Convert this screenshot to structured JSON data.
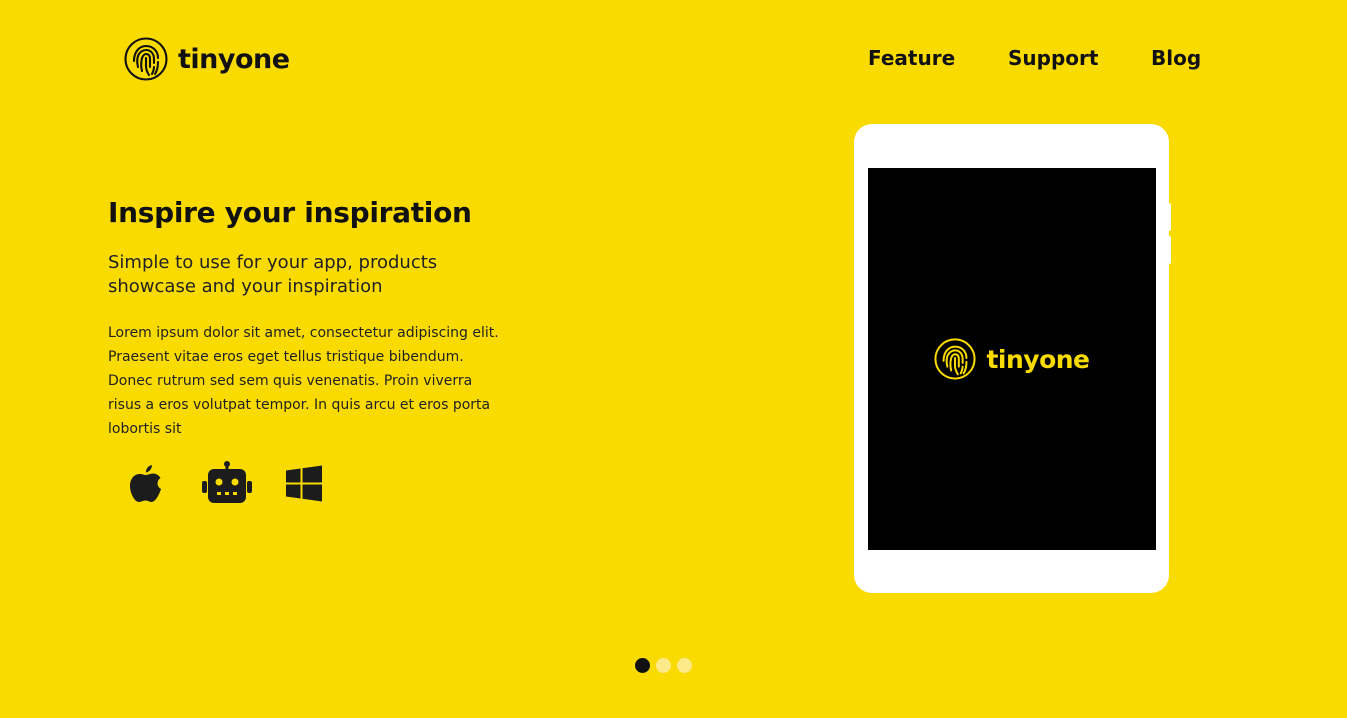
{
  "brand": {
    "name": "tinyone"
  },
  "nav": {
    "items": [
      {
        "label": "Feature"
      },
      {
        "label": "Support"
      },
      {
        "label": "Blog"
      }
    ]
  },
  "hero": {
    "title": "Inspire your inspiration",
    "subtitle": "Simple to use for your app, products showcase and your inspiration",
    "body": "Lorem ipsum dolor sit amet, consectetur adipiscing elit. Praesent vitae eros eget tellus tristique bibendum. Donec rutrum sed sem quis venenatis. Proin viverra risus a eros volutpat tempor. In quis arcu et eros porta lobortis sit"
  },
  "platforms": [
    {
      "icon": "apple-icon"
    },
    {
      "icon": "android-robot-icon"
    },
    {
      "icon": "windows-icon"
    }
  ],
  "device": {
    "screen_brand": "tinyone"
  },
  "slider": {
    "count": 3,
    "active_index": 0
  },
  "colors": {
    "background": "#fadb00",
    "text": "#111111",
    "screen": "#000000",
    "device": "#ffffff",
    "dot_inactive": "#fce98a"
  }
}
